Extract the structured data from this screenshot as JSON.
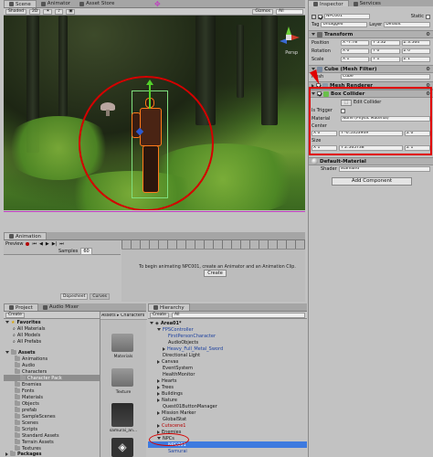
{
  "scene": {
    "tabs": [
      {
        "label": "Scene"
      },
      {
        "label": "Animator"
      },
      {
        "label": "Asset Store"
      }
    ],
    "toolbar": {
      "shading": "Shaded",
      "mode": "2D",
      "gizmos": "Gizmos",
      "search": "All"
    },
    "gizmo_label": "Persp"
  },
  "inspector": {
    "tabs": [
      {
        "label": "Inspector"
      },
      {
        "label": "Services"
      }
    ],
    "object_name": "NPC001",
    "static_label": "Static",
    "tag_label": "Tag",
    "tag_value": "Untagged",
    "layer_label": "Layer",
    "layer_value": "Default",
    "transform": {
      "title": "Transform",
      "position_label": "Position",
      "rotation_label": "Rotation",
      "scale_label": "Scale",
      "position": [
        "X -7.78",
        "Y 5.32",
        "Z 3.564"
      ],
      "rotation": [
        "X 0",
        "Y 0",
        "Z 0"
      ],
      "scale": [
        "X 1",
        "Y 1",
        "Z 1"
      ]
    },
    "mesh_filter": {
      "title": "Cube (Mesh Filter)",
      "mesh_label": "Mesh",
      "mesh_value": "Cube"
    },
    "mesh_renderer": {
      "title": "Mesh Renderer"
    },
    "box_collider": {
      "title": "Box Collider",
      "edit_label": "Edit Collider",
      "is_trigger_label": "Is Trigger",
      "material_label": "Material",
      "material_value": "None (Physic Material)",
      "center_label": "Center",
      "center": [
        "X 0",
        "Y -0.5353949",
        "Z 0"
      ],
      "size_label": "Size",
      "size": [
        "X 1",
        "Y 2.565738",
        "Z 1"
      ]
    },
    "material": {
      "title": "Default-Material",
      "shader_label": "Shader",
      "shader_value": "Standard"
    },
    "add_component": "Add Component",
    "colors": {
      "highlight": "#e00000"
    }
  },
  "animation": {
    "tab": "Animation",
    "preview": "Preview",
    "samples_label": "Samples",
    "samples_value": "60",
    "dopesheet": "Dopesheet",
    "curves": "Curves",
    "message": "To begin animating NPC001, create an Animator and an Animation Clip.",
    "create_button": "Create"
  },
  "project": {
    "tabs": [
      {
        "label": "Project"
      },
      {
        "label": "Audio Mixer"
      }
    ],
    "create_button": "Create",
    "breadcrumb": "Assets ▸ Characters",
    "favorites_label": "Favorites",
    "favorites": [
      "All Materials",
      "All Models",
      "All Prefabs"
    ],
    "assets_label": "Assets",
    "tree": [
      {
        "label": "Animations",
        "indent": 1
      },
      {
        "label": "Audio",
        "indent": 1
      },
      {
        "label": "Characters",
        "indent": 1
      },
      {
        "label": "Character Pack",
        "indent": 2,
        "selected": true
      },
      {
        "label": "Enemies",
        "indent": 1
      },
      {
        "label": "Fonts",
        "indent": 1
      },
      {
        "label": "Materials",
        "indent": 1
      },
      {
        "label": "Objects",
        "indent": 1
      },
      {
        "label": "prefab",
        "indent": 1
      },
      {
        "label": "SampleScenes",
        "indent": 1
      },
      {
        "label": "Scenes",
        "indent": 1
      },
      {
        "label": "Scripts",
        "indent": 1
      },
      {
        "label": "Standard Assets",
        "indent": 1
      },
      {
        "label": "Terrain Assets",
        "indent": 1
      },
      {
        "label": "Textures",
        "indent": 1
      }
    ],
    "packages_label": "Packages",
    "grid_items": [
      {
        "label": "Materials"
      },
      {
        "label": "Texture"
      },
      {
        "label": "samurai_an..."
      },
      {
        "label": ""
      }
    ]
  },
  "hierarchy": {
    "tab": "Hierarchy",
    "create_button": "Create",
    "search_placeholder": "All",
    "scene_name": "Area01*",
    "items": [
      {
        "label": "FPSController",
        "indent": 1,
        "style": "blue",
        "arrow": "down"
      },
      {
        "label": "FirstPersonCharacter",
        "indent": 2,
        "style": "blue",
        "arrow": ""
      },
      {
        "label": "AudioObjects",
        "indent": 2,
        "style": "normal",
        "arrow": ""
      },
      {
        "label": "Heavy_Full_Metal_Sword",
        "indent": 2,
        "style": "blue",
        "arrow": "right"
      },
      {
        "label": "Directional Light",
        "indent": 1,
        "style": "normal",
        "arrow": ""
      },
      {
        "label": "Canvas",
        "indent": 1,
        "style": "normal",
        "arrow": "right"
      },
      {
        "label": "EventSystem",
        "indent": 1,
        "style": "normal",
        "arrow": ""
      },
      {
        "label": "HealthMonitor",
        "indent": 1,
        "style": "normal",
        "arrow": ""
      },
      {
        "label": "Hearts",
        "indent": 1,
        "style": "normal",
        "arrow": "right"
      },
      {
        "label": "Trees",
        "indent": 1,
        "style": "normal",
        "arrow": "right"
      },
      {
        "label": "Buildings",
        "indent": 1,
        "style": "normal",
        "arrow": "right"
      },
      {
        "label": "Nature",
        "indent": 1,
        "style": "normal",
        "arrow": "right"
      },
      {
        "label": "Quest01ButtonManager",
        "indent": 1,
        "style": "normal",
        "arrow": ""
      },
      {
        "label": "Mission Marker",
        "indent": 1,
        "style": "normal",
        "arrow": "right"
      },
      {
        "label": "GlobalStat",
        "indent": 1,
        "style": "normal",
        "arrow": ""
      },
      {
        "label": "Cutscene1",
        "indent": 1,
        "style": "red",
        "arrow": "right"
      },
      {
        "label": "Enemies",
        "indent": 1,
        "style": "normal",
        "arrow": "right"
      },
      {
        "label": "NPCs",
        "indent": 1,
        "style": "normal",
        "arrow": "down"
      },
      {
        "label": "NPC001",
        "indent": 2,
        "style": "selected",
        "arrow": ""
      },
      {
        "label": "Samurai",
        "indent": 2,
        "style": "blue",
        "arrow": ""
      }
    ]
  }
}
